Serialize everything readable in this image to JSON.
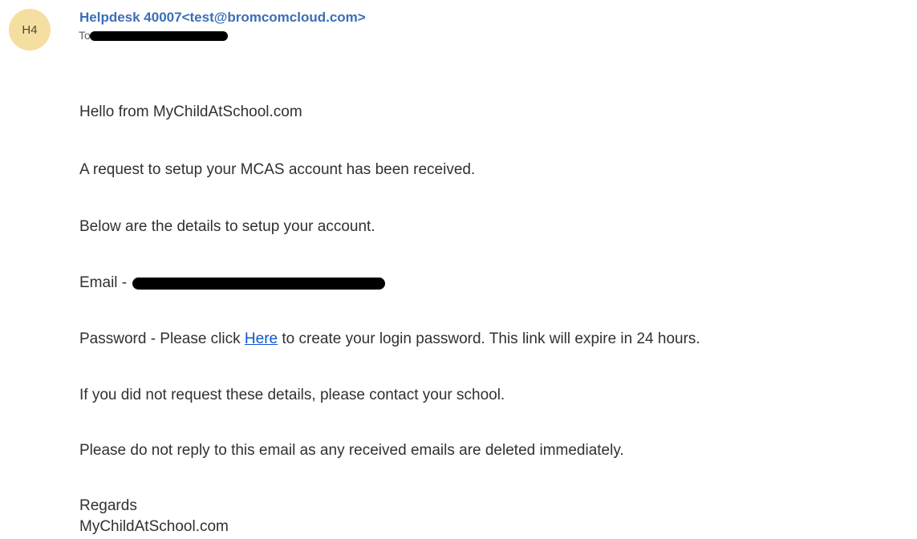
{
  "sender": {
    "avatar_initials": "H4",
    "display": "Helpdesk 40007<test@bromcomcloud.com>",
    "avatar_color": "#f5dfa0",
    "name_color": "#3b6fb6"
  },
  "to_line": {
    "label": "To:"
  },
  "body": {
    "greeting": "Hello from MyChildAtSchool.com",
    "request": "A request to setup your MCAS account has been received.",
    "below": "Below are the details to setup your account.",
    "email_label": "Email - ",
    "password_prefix": "Password - Please click ",
    "password_link": "Here",
    "password_suffix": " to create your login password. This link will expire in 24 hours.",
    "contact": "If you did not request these details, please contact your school.",
    "no_reply": "Please do not reply to this email as any received emails are deleted immediately.",
    "regards": "Regards",
    "signature": "MyChildAtSchool.com"
  },
  "colors": {
    "link": "#0b57d0",
    "text": "#323130"
  }
}
